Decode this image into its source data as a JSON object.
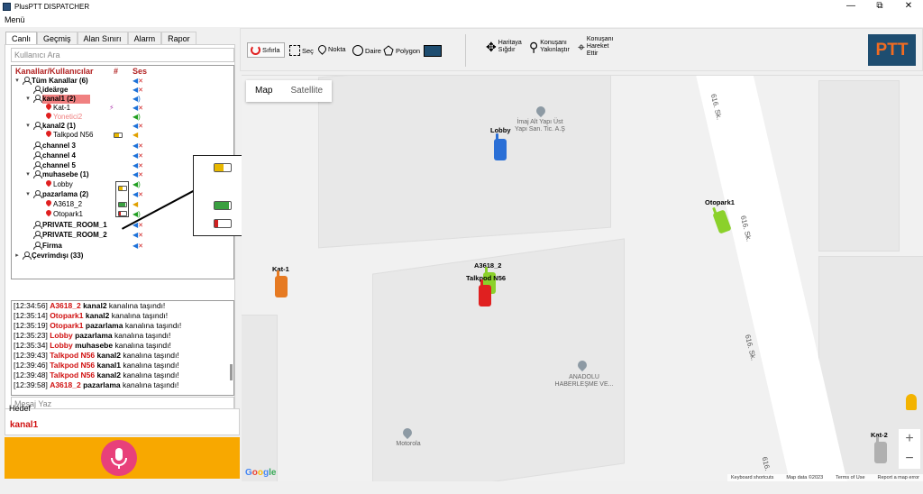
{
  "window": {
    "title": "PlusPTT DISPATCHER",
    "minimize": "—",
    "restore": "⧉",
    "close": "✕"
  },
  "menu": {
    "label": "Menü"
  },
  "tabs": [
    "Canlı",
    "Geçmiş",
    "Alan Sınırı",
    "Alarm",
    "Rapor"
  ],
  "user_search": {
    "placeholder": "Kullanıcı Ara"
  },
  "tree": {
    "header": "Kanallar/Kullanıcılar",
    "hash_col": "#",
    "ses_col": "Ses",
    "rows": [
      {
        "label": "Tüm Kanallar (6)"
      },
      {
        "label": "ideärge"
      },
      {
        "label": "kanal1 (2)"
      },
      {
        "label": "Kat-1"
      },
      {
        "label": "Yonetici2"
      },
      {
        "label": "kanal2 (1)"
      },
      {
        "label": "Talkpod N56"
      },
      {
        "label": "channel 3"
      },
      {
        "label": "channel 4"
      },
      {
        "label": "channel 5"
      },
      {
        "label": "muhasebe (1)"
      },
      {
        "label": "Lobby"
      },
      {
        "label": "pazarlama (2)"
      },
      {
        "label": "A3618_2"
      },
      {
        "label": "Otopark1"
      },
      {
        "label": "PRIVATE_ROOM_1"
      },
      {
        "label": "PRIVATE_ROOM_2"
      },
      {
        "label": "Firma"
      },
      {
        "label": "Çevrimdışı (33)"
      }
    ]
  },
  "log": [
    {
      "time": "[12:34:56]",
      "who": "A3618_2",
      "ch": "kanal2",
      "msg": "kanalına taşındı!"
    },
    {
      "time": "[12:35:14]",
      "who": "Otopark1",
      "ch": "kanal2",
      "msg": "kanalına taşındı!"
    },
    {
      "time": "[12:35:19]",
      "who": "Otopark1",
      "ch": "pazarlama",
      "msg": "kanalına taşındı!"
    },
    {
      "time": "[12:35:23]",
      "who": "Lobby",
      "ch": "pazarlama",
      "msg": "kanalına taşındı!"
    },
    {
      "time": "[12:35:34]",
      "who": "Lobby",
      "ch": "muhasebe",
      "msg": "kanalına taşındı!"
    },
    {
      "time": "[12:39:43]",
      "who": "Talkpod N56",
      "ch": "kanal2",
      "msg": "kanalına taşındı!"
    },
    {
      "time": "[12:39:46]",
      "who": "Talkpod N56",
      "ch": "kanal1",
      "msg": "kanalına taşındı!"
    },
    {
      "time": "[12:39:48]",
      "who": "Talkpod N56",
      "ch": "kanal2",
      "msg": "kanalına taşındı!"
    },
    {
      "time": "[12:39:58]",
      "who": "A3618_2",
      "ch": "pazarlama",
      "msg": "kanalına taşındı!"
    }
  ],
  "message": {
    "placeholder": "Mesaj Yaz"
  },
  "target": {
    "label": "Hedef",
    "value": "kanal1"
  },
  "toolbar": {
    "reset": "Sıfırla",
    "select": "Seç",
    "point": "Nokta",
    "circle": "Daire",
    "polygon": "Polygon",
    "fit_map": [
      "Haritaya",
      "Sığdır"
    ],
    "zoom_speaker": [
      "Konuşanı",
      "Yakınlaştır"
    ],
    "move_speaker": [
      "Konuşanı",
      "Hareket",
      "Ettir"
    ],
    "logo": "PTT"
  },
  "map": {
    "type_map": "Map",
    "type_satellite": "Satellite",
    "poi_imaj": [
      "İmaj Alt Yapı Üst",
      "Yapı San. Tic. A.Ş"
    ],
    "poi_anadolu": [
      "ANADOLU",
      "HABERLEŞME VE..."
    ],
    "poi_motorola": "Motorola",
    "street_1": "616. Sk.",
    "street_2": "616. Sk.",
    "street_3": "616. Sk.",
    "street_4": "616.",
    "devices": {
      "lobby": "Lobby",
      "otopark": "Otopark1",
      "kat1": "Kat-1",
      "a3618": "A3618_2",
      "talkpod": "Talkpod N56",
      "kat2": "Kat-2"
    },
    "google": "Google",
    "footer": [
      "Keyboard shortcuts",
      "Map data ©2023",
      "Terms of Use",
      "Report a map error"
    ],
    "zoom_in": "+",
    "zoom_out": "−"
  },
  "colors": {
    "accent": "#f8a800",
    "mic": "#e8407a",
    "logo_bg": "#1e4d70",
    "logo_fg": "#f26c21"
  }
}
